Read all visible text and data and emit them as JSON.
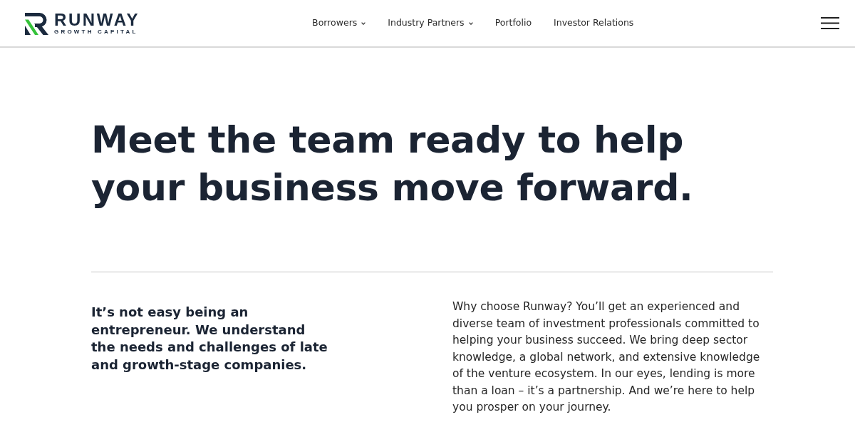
{
  "header": {
    "logo": {
      "wordmark": "RUNWAY",
      "tagline": "GROWTH CAPITAL"
    },
    "nav": [
      {
        "label": "Borrowers",
        "has_dropdown": true
      },
      {
        "label": "Industry Partners",
        "has_dropdown": true
      },
      {
        "label": "Portfolio",
        "has_dropdown": false
      },
      {
        "label": "Investor Relations",
        "has_dropdown": false
      }
    ]
  },
  "hero": {
    "headline": "Meet the team ready to help your business move forward."
  },
  "intro": {
    "lead": "It’s not easy being an entrepreneur. We understand the needs and challenges of late and growth-stage companies.",
    "body": "Why choose Runway? You’ll get an experienced and diverse team of investment professionals committed to helping your business succeed. We bring deep sector knowledge, a global network, and extensive knowledge of the venture ecosystem. In our eyes, lending is more than a loan – it’s a partnership. And we’re here to help you prosper on your journey."
  }
}
